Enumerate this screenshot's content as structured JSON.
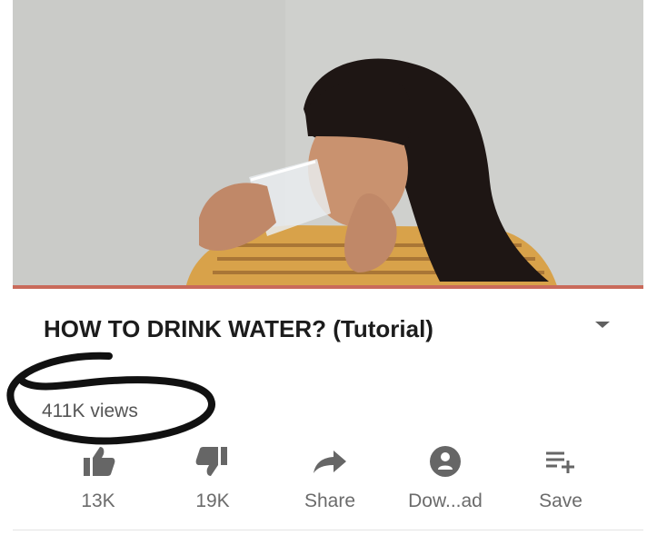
{
  "video": {
    "title": "HOW TO DRINK WATER? (Tutorial)",
    "views": "411K views"
  },
  "actions": [
    {
      "label": "13K",
      "icon": "thumbs-up-icon"
    },
    {
      "label": "19K",
      "icon": "thumbs-down-icon"
    },
    {
      "label": "Share",
      "icon": "share-icon"
    },
    {
      "label": "Dow...ad",
      "icon": "download-icon"
    },
    {
      "label": "Save",
      "icon": "save-playlist-icon"
    }
  ],
  "colors": {
    "text": "#1c1c1c",
    "muted": "#6b6b6b",
    "progress": "#c96a5a"
  }
}
